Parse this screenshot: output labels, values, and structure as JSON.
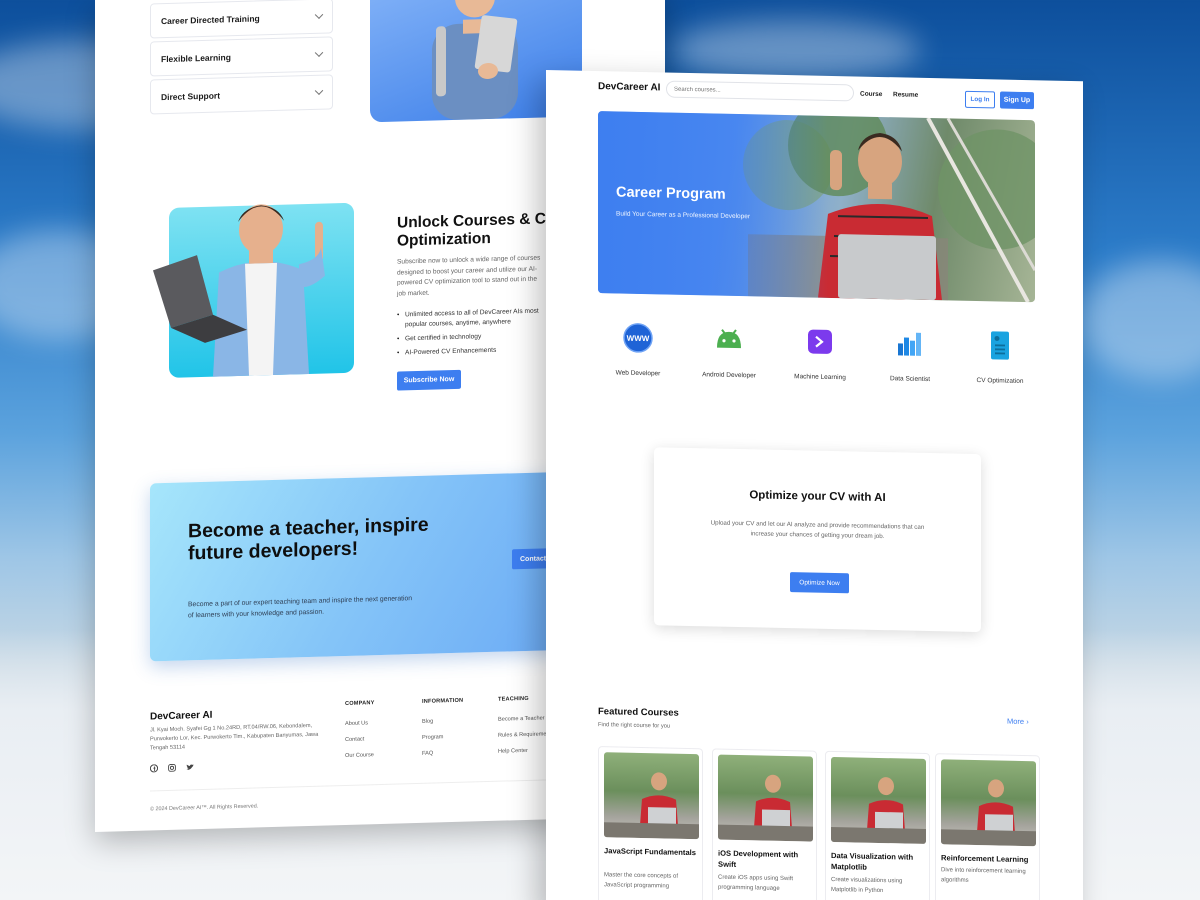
{
  "left": {
    "accordion": [
      "Career Directed Training",
      "Flexible Learning",
      "Direct Support"
    ],
    "unlock": {
      "title": "Unlock Courses & CV Optimization",
      "description": "Subscribe now to unlock a wide range of courses designed to boost your career and utilize our AI-powered CV optimization tool to stand out in the job market.",
      "bullets": [
        "Unlimited access to all of DevCareer AIs most popular courses, anytime, anywhere",
        "Get certified in technology",
        "AI-Powered CV Enhancements"
      ],
      "button": "Subscribe Now"
    },
    "teacher": {
      "title": "Become a teacher, inspire future developers!",
      "description": "Become a part of our expert teaching team and inspire the next generation of learners with your knowledge and passion.",
      "button": "Contact"
    },
    "footer": {
      "brand": "DevCareer AI",
      "address": "Jl. Kyai Moch. Syafei Gg 1 No.24RD, RT.04/RW.06, Kebondalem, Purwokerto Lor, Kec. Purwokerto Tim., Kabupaten Banyumas, Jawa Tengah 53114",
      "columns": [
        {
          "heading": "COMPANY",
          "links": [
            "About Us",
            "Contact",
            "Our Course"
          ]
        },
        {
          "heading": "INFORMATION",
          "links": [
            "Blog",
            "Program",
            "FAQ"
          ]
        },
        {
          "heading": "TEACHING",
          "links": [
            "Become a Teacher",
            "Rules & Requirements",
            "Help Center"
          ]
        }
      ],
      "copyright": "© 2024 DevCareer AI™. All Rights Reserved."
    }
  },
  "right": {
    "brand": "DevCareer AI",
    "search_placeholder": "Search courses...",
    "nav": [
      "Course",
      "Resume"
    ],
    "login": "Log In",
    "signup": "Sign Up",
    "hero": {
      "title": "Career Program",
      "subtitle": "Build Your Career as a Professional Developer"
    },
    "categories": [
      {
        "label": "Web Developer",
        "icon": "www-globe-icon",
        "color": "#1e63d6"
      },
      {
        "label": "Android Developer",
        "icon": "android-icon",
        "color": "#4caf50"
      },
      {
        "label": "Machine Learning",
        "icon": "terminal-icon",
        "color": "#7c3aed"
      },
      {
        "label": "Data Scientist",
        "icon": "bar-chart-icon",
        "color": "#1976d2"
      },
      {
        "label": "CV Optimization",
        "icon": "document-icon",
        "color": "#1aa3e0"
      }
    ],
    "optimize": {
      "title": "Optimize your CV with AI",
      "description": "Upload your CV and let our AI analyze and provide recommendations that can increase your chances of getting your dream job.",
      "button": "Optimize Now"
    },
    "featured": {
      "title": "Featured Courses",
      "subtitle": "Find the right course for you",
      "more": "More",
      "courses": [
        {
          "title": "JavaScript Fundamentals",
          "description": "Master the core concepts of JavaScript programming"
        },
        {
          "title": "iOS Development with Swift",
          "description": "Create iOS apps using Swift programming language"
        },
        {
          "title": "Data Visualization with Matplotlib",
          "description": "Create visualizations using Matplotlib in Python"
        },
        {
          "title": "Reinforcement Learning",
          "description": "Dive into reinforcement learning algorithms"
        }
      ]
    }
  }
}
